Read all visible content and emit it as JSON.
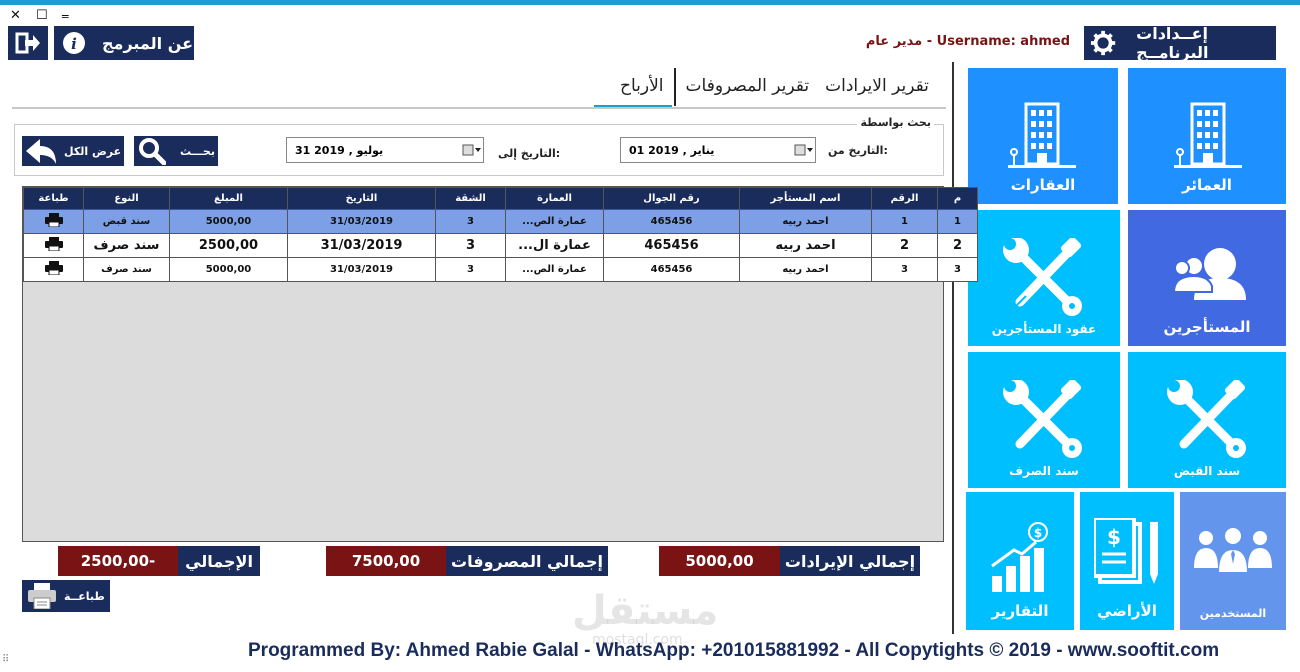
{
  "window": {
    "close": "✕",
    "maximize": "☐",
    "minimize": "‗"
  },
  "header": {
    "about_label": "عن المبرمج",
    "settings_label": "إعــدادات البرنامــج",
    "user_line": "مدير عام - Username: ahmed"
  },
  "tiles": {
    "buildings": "العمائر",
    "properties": "العقارات",
    "tenants": "المستأجرين",
    "tenant_contracts": "عقود المستأجرين",
    "receipt": "سند القبض",
    "payment": "سند الصرف",
    "users": "المستخدمين",
    "lands": "الأراضي",
    "reports": "التقارير"
  },
  "tabs": [
    "تقرير الايرادات",
    "تقرير المصروفات",
    "الأرباح"
  ],
  "search": {
    "legend": "بحث بواسطة",
    "from_label": "التاريخ من:",
    "from_value": "01   يناير  ,  2019",
    "to_label": "التاريخ إلى:",
    "to_value": "31   يوليو  ,  2019",
    "search_button": "بحـــث",
    "show_all_button": "عرض الكل"
  },
  "table": {
    "columns": [
      "م",
      "الرقم",
      "اسم المستأجر",
      "رقم الجوال",
      "العمارة",
      "الشقة",
      "التاريخ",
      "المبلغ",
      "النوع",
      "طباعة"
    ],
    "rows": [
      [
        "1",
        "1",
        "احمد ربيه",
        "465456",
        "عمارة الص...",
        "3",
        "31/03/2019",
        "5000,00",
        "سند قبض",
        ""
      ],
      [
        "2",
        "2",
        "احمد ربيه",
        "465456",
        "عمارة ال...",
        "3",
        "31/03/2019",
        "2500,00",
        "سند صرف",
        ""
      ],
      [
        "3",
        "3",
        "احمد ربيه",
        "465456",
        "عمارة الص...",
        "3",
        "31/03/2019",
        "5000,00",
        "سند صرف",
        ""
      ]
    ]
  },
  "totals": {
    "revenue_label": "إجمالي الإيرادات",
    "revenue_value": "5000,00",
    "expenses_label": "إجمالي المصروفات",
    "expenses_value": "7500,00",
    "net_label": "الإجمالي",
    "net_value": "2500,00-"
  },
  "print_button": "طباعــة",
  "footer": "Programmed By: Ahmed Rabie Galal - WhatsApp: +201015881992 - All Copytights © 2019 - www.sooftit.com",
  "watermark": "مستقل",
  "watermark_sub": "mostaql.com",
  "colors": {
    "navy": "#1a2c5c",
    "accent": "#1a9ed4",
    "tile_cyan": "#00bfff",
    "tile_blue": "#1e90ff",
    "tile_royal": "#4169e1",
    "tile_soft": "#6495ed",
    "maroon": "#7a1414"
  }
}
